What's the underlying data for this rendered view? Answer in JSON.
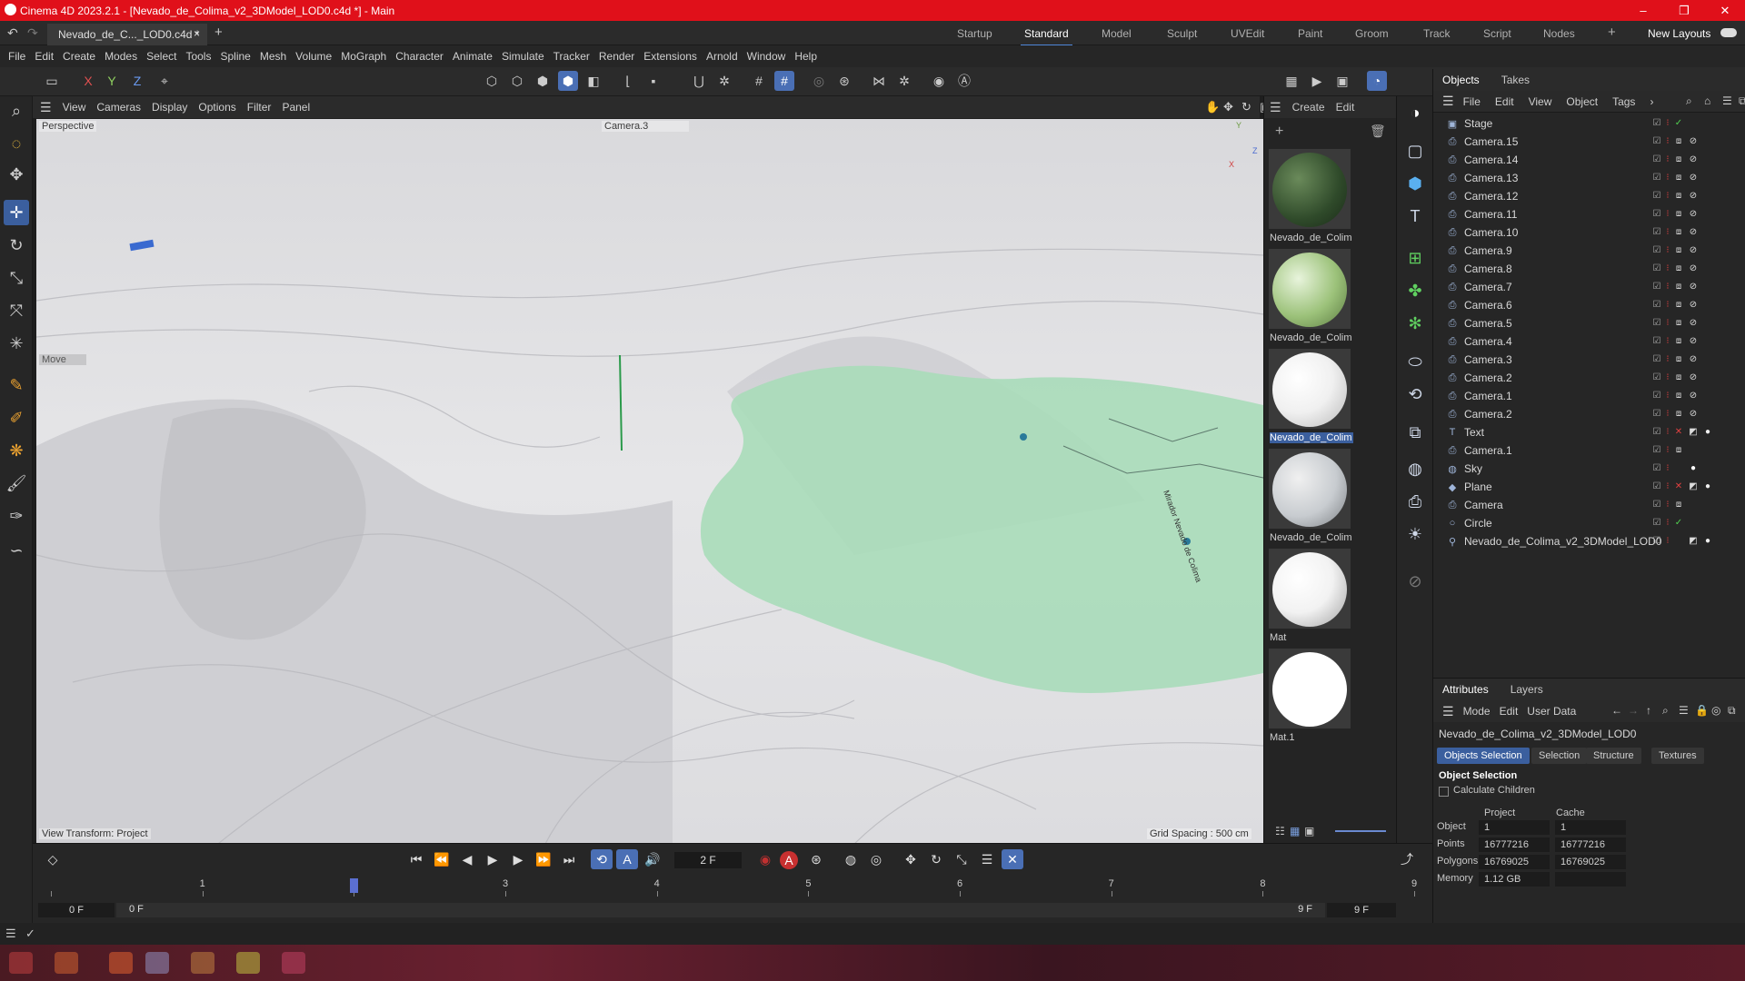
{
  "window": {
    "title": "Cinema 4D 2023.2.1 - [Nevado_de_Colima_v2_3DModel_LOD0.c4d *] - Main",
    "controls": [
      "–",
      "❐",
      "✕"
    ]
  },
  "doc_tab": {
    "label": "Nevado_de_C..._LOD0.c4d *",
    "close": "×",
    "add": "+"
  },
  "layouts": {
    "items": [
      "Startup",
      "Standard",
      "Model",
      "Sculpt",
      "UVEdit",
      "Paint",
      "Groom",
      "Track",
      "Script",
      "Nodes"
    ],
    "active": "Standard",
    "add": "+",
    "new_layouts": "New Layouts"
  },
  "menu": [
    "File",
    "Edit",
    "Create",
    "Modes",
    "Select",
    "Tools",
    "Spline",
    "Mesh",
    "Volume",
    "MoGraph",
    "Character",
    "Animate",
    "Simulate",
    "Tracker",
    "Render",
    "Extensions",
    "Arnold",
    "Window",
    "Help"
  ],
  "toolbar": {
    "axis_x": "X",
    "axis_y": "Y",
    "axis_z": "Z"
  },
  "viewport": {
    "menu": [
      "View",
      "Cameras",
      "Display",
      "Options",
      "Filter",
      "Panel"
    ],
    "label_perspective": "Perspective",
    "label_camera": "Camera.3",
    "label_move": "Move",
    "label_view_transform": "View Transform: Project",
    "label_grid": "Grid Spacing : 500 cm",
    "axis_y": "Y",
    "axis_z": "Z",
    "axis_x": "X"
  },
  "materials": {
    "menu": [
      "Create",
      "Edit"
    ],
    "items": [
      {
        "name": "Nevado_de_Colim",
        "color": "#2f4a2a",
        "selected": false
      },
      {
        "name": "Nevado_de_Colim",
        "color": "#9cc27a",
        "selected": false
      },
      {
        "name": "Nevado_de_Colim",
        "color": "#f0f0f0",
        "selected": true
      },
      {
        "name": "Nevado_de_Colim",
        "color": "#c8ccd0",
        "selected": false
      },
      {
        "name": "Mat",
        "color": "#f2f2f2",
        "selected": false
      },
      {
        "name": "Mat.1",
        "color": "#ffffff",
        "selected": false
      }
    ]
  },
  "objects": {
    "tabs": [
      "Objects",
      "Takes"
    ],
    "menu": [
      "File",
      "Edit",
      "View",
      "Object",
      "Tags"
    ],
    "rows": [
      {
        "name": "Stage",
        "icon": "stage-icon"
      },
      {
        "name": "Camera.15",
        "icon": "camera-icon"
      },
      {
        "name": "Camera.14",
        "icon": "camera-icon"
      },
      {
        "name": "Camera.13",
        "icon": "camera-icon"
      },
      {
        "name": "Camera.12",
        "icon": "camera-icon"
      },
      {
        "name": "Camera.11",
        "icon": "camera-icon"
      },
      {
        "name": "Camera.10",
        "icon": "camera-icon"
      },
      {
        "name": "Camera.9",
        "icon": "camera-icon"
      },
      {
        "name": "Camera.8",
        "icon": "camera-icon"
      },
      {
        "name": "Camera.7",
        "icon": "camera-icon"
      },
      {
        "name": "Camera.6",
        "icon": "camera-icon"
      },
      {
        "name": "Camera.5",
        "icon": "camera-icon"
      },
      {
        "name": "Camera.4",
        "icon": "camera-icon"
      },
      {
        "name": "Camera.3",
        "icon": "camera-icon"
      },
      {
        "name": "Camera.2",
        "icon": "camera-icon"
      },
      {
        "name": "Camera.1",
        "icon": "camera-icon"
      },
      {
        "name": "Camera.2",
        "icon": "camera-icon"
      },
      {
        "name": "Text",
        "icon": "text-icon"
      },
      {
        "name": "Camera.1",
        "icon": "camera-icon"
      },
      {
        "name": "Sky",
        "icon": "sky-icon"
      },
      {
        "name": "Plane",
        "icon": "plane-icon"
      },
      {
        "name": "Camera",
        "icon": "camera-icon"
      },
      {
        "name": "Circle",
        "icon": "circle-icon"
      },
      {
        "name": "Nevado_de_Colima_v2_3DModel_LOD0",
        "icon": "mesh-icon"
      }
    ]
  },
  "attributes": {
    "tabs": [
      "Attributes",
      "Layers"
    ],
    "menu": [
      "Mode",
      "Edit",
      "User Data"
    ],
    "object_name": "Nevado_de_Colima_v2_3DModel_LOD0",
    "buttons": [
      "Objects Selection",
      "Selection",
      "Structure",
      "Textures"
    ],
    "section": "Object Selection",
    "checkbox_label": "Calculate Children",
    "col_project": "Project",
    "col_cache": "Cache",
    "stats": [
      {
        "label": "Object",
        "project": "1",
        "cache": "1"
      },
      {
        "label": "Points",
        "project": "16777216",
        "cache": "16777216"
      },
      {
        "label": "Polygons",
        "project": "16769025",
        "cache": "16769025"
      },
      {
        "label": "Memory",
        "project": "1.12 GB",
        "cache": ""
      }
    ]
  },
  "timeline": {
    "current_frame": "2 F",
    "ticks": [
      "0",
      "1",
      "2",
      "3",
      "4",
      "5",
      "6",
      "7",
      "8",
      "9"
    ],
    "start": "0 F",
    "range_start": "0 F",
    "range_end": "9 F",
    "end": "9 F",
    "playhead_frame": 2
  },
  "colors": {
    "accent": "#4a6fb5",
    "title_red": "#e0101a",
    "terrain_green": "#a9dcb9"
  }
}
